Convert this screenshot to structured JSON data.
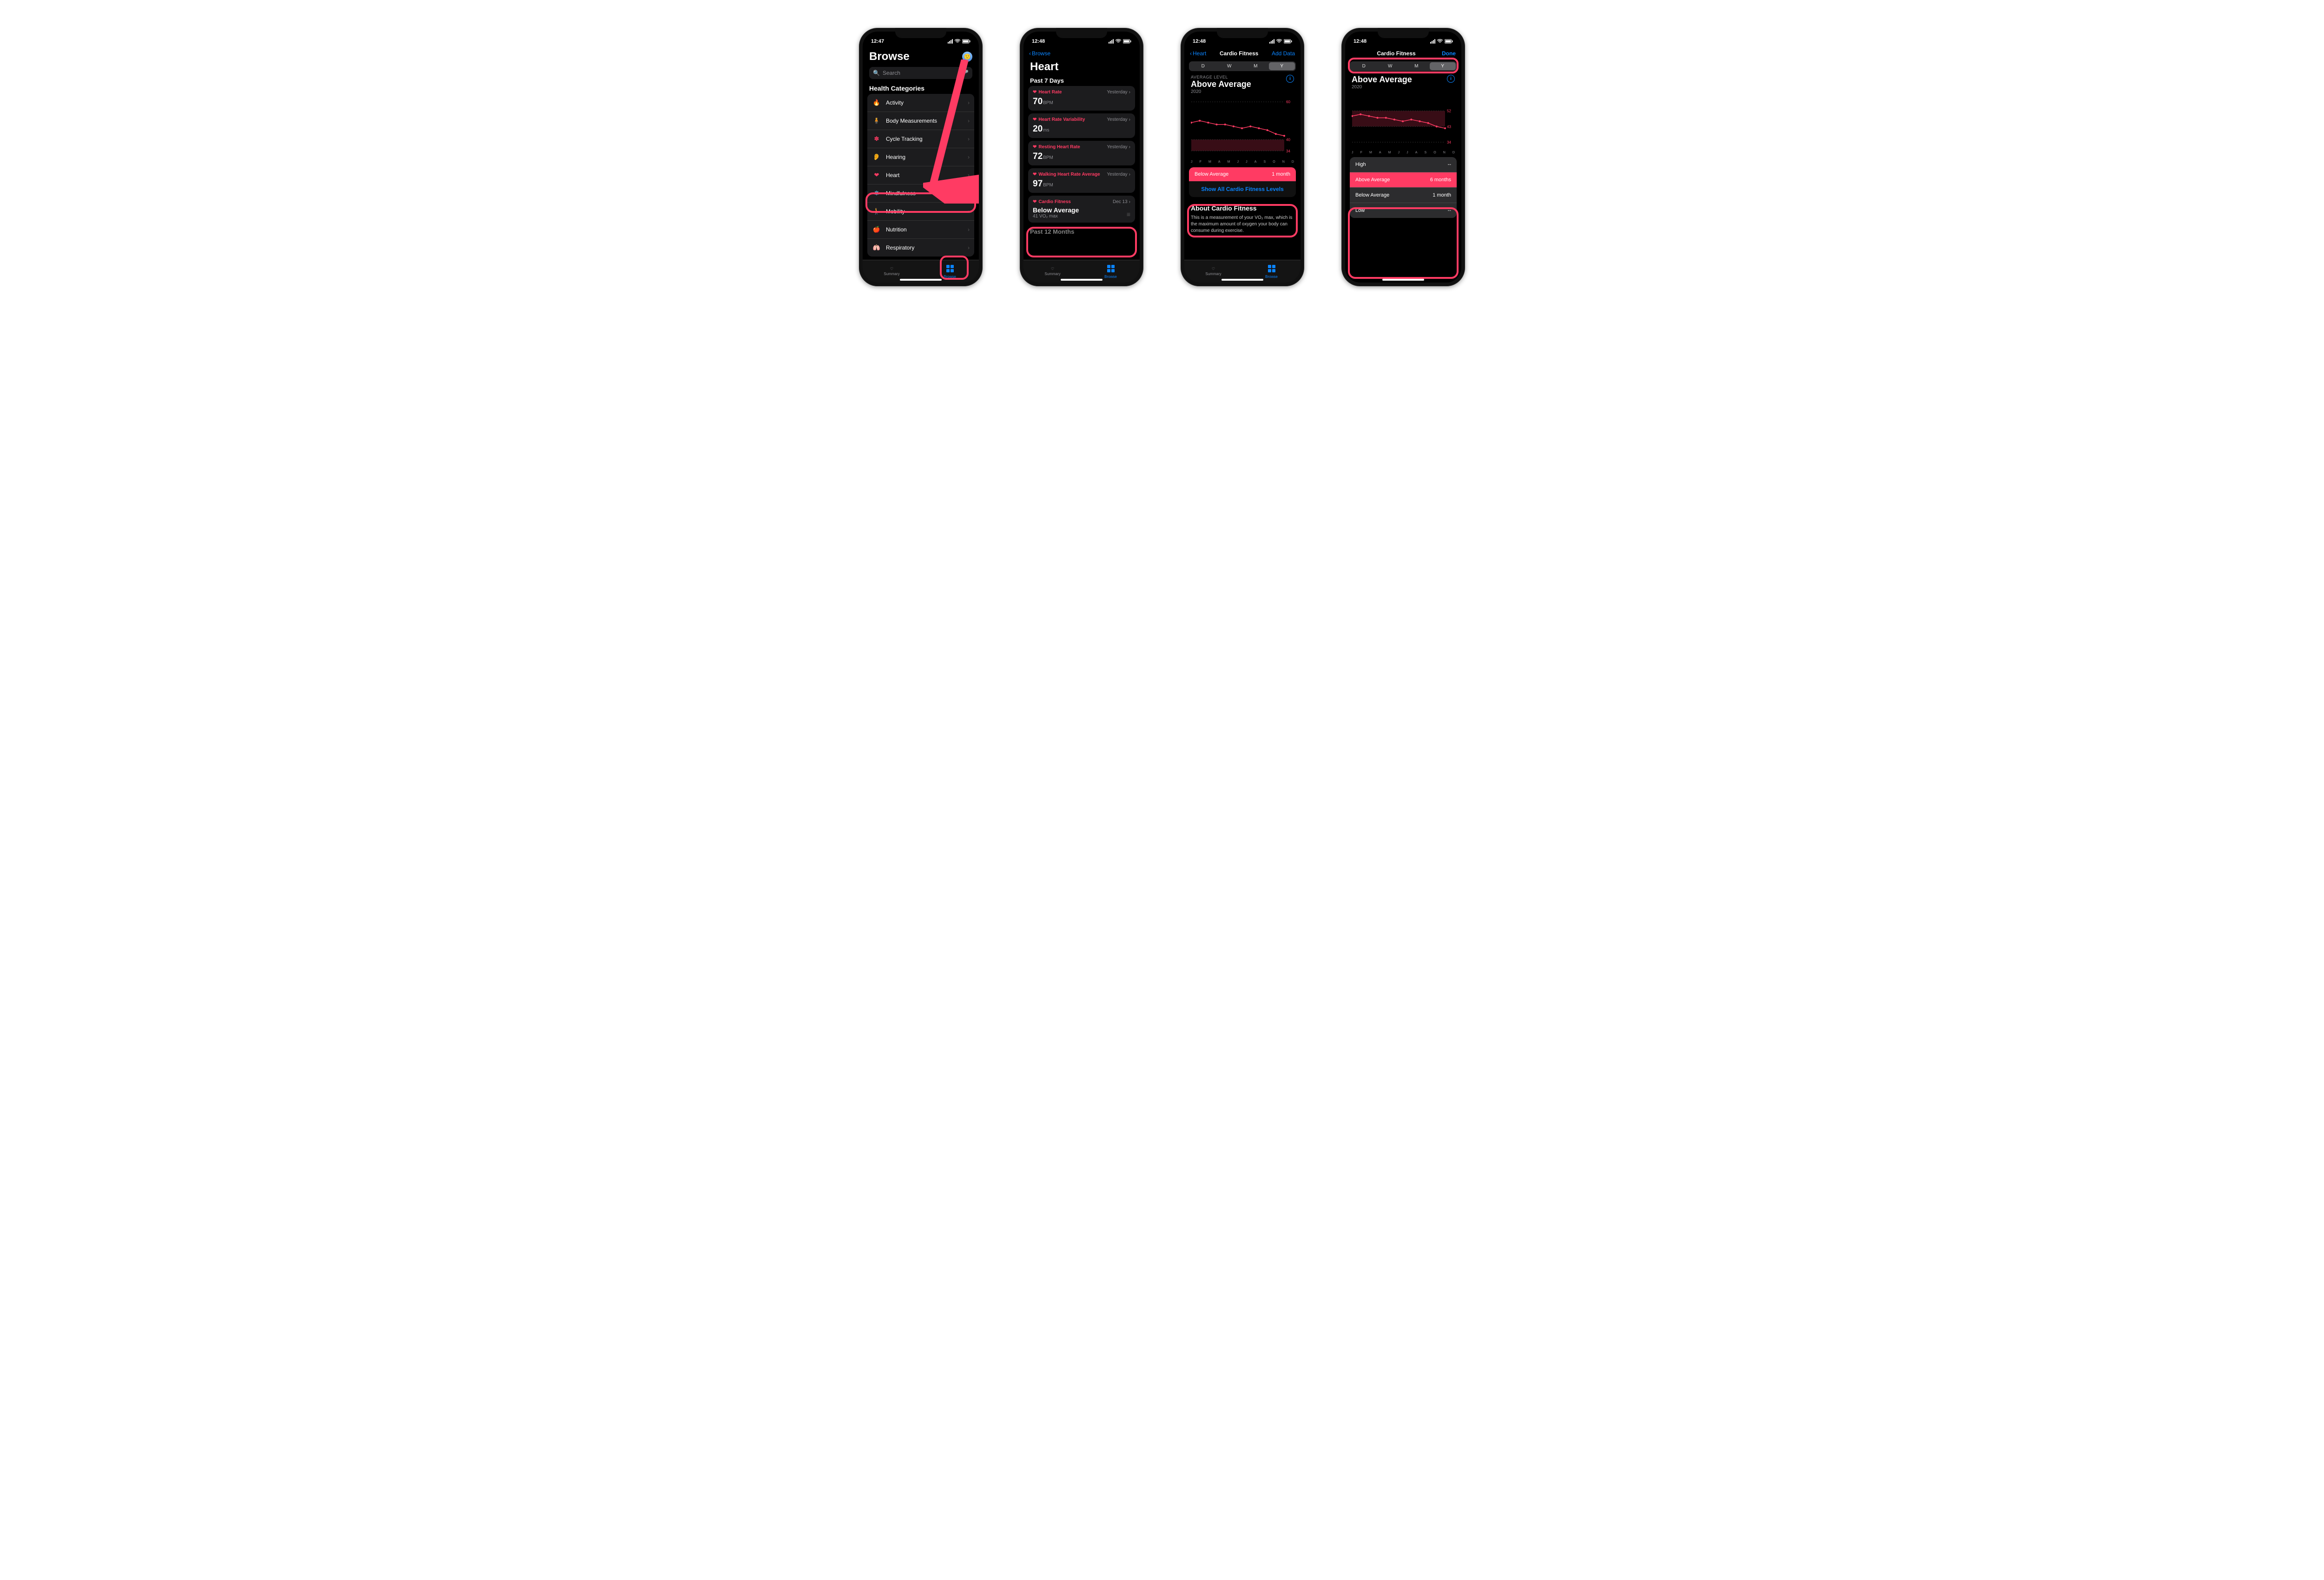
{
  "status": {
    "time_a": "12:47",
    "time_b": "12:48",
    "loc_arrow": "↗"
  },
  "screen1": {
    "title": "Browse",
    "search_placeholder": "Search",
    "categories_header": "Health Categories",
    "categories": [
      {
        "icon": "flame",
        "label": "Activity",
        "color": "#ff9500"
      },
      {
        "icon": "body",
        "label": "Body Measurements",
        "color": "#bf5af2"
      },
      {
        "icon": "cycle",
        "label": "Cycle Tracking",
        "color": "#ff3b63"
      },
      {
        "icon": "ear",
        "label": "Hearing",
        "color": "#0a84ff"
      },
      {
        "icon": "heart",
        "label": "Heart",
        "color": "#ff3b63"
      },
      {
        "icon": "mind",
        "label": "Mindfulness",
        "color": "#64d2ff"
      },
      {
        "icon": "mobility",
        "label": "Mobility",
        "color": "#ff9500"
      },
      {
        "icon": "nutrition",
        "label": "Nutrition",
        "color": "#30d158"
      },
      {
        "icon": "lungs",
        "label": "Respiratory",
        "color": "#5ac8fa"
      }
    ],
    "tabs": {
      "summary": "Summary",
      "browse": "Browse"
    }
  },
  "screen2": {
    "back": "Browse",
    "title": "Heart",
    "section": "Past 7 Days",
    "section2": "Past 12 Months",
    "metrics": [
      {
        "name": "Heart Rate",
        "when": "Yesterday",
        "value": "70",
        "unit": "BPM"
      },
      {
        "name": "Heart Rate Variability",
        "when": "Yesterday",
        "value": "20",
        "unit": "ms"
      },
      {
        "name": "Resting Heart Rate",
        "when": "Yesterday",
        "value": "72",
        "unit": "BPM"
      },
      {
        "name": "Walking Heart Rate Average",
        "when": "Yesterday",
        "value": "97",
        "unit": "BPM"
      },
      {
        "name": "Cardio Fitness",
        "when": "Dec 13",
        "value": "Below Average",
        "sub": "41 VO₂ max"
      }
    ]
  },
  "screen3": {
    "back": "Heart",
    "title": "Cardio Fitness",
    "action": "Add Data",
    "seg": [
      "D",
      "W",
      "M",
      "Y"
    ],
    "seg_sel": 3,
    "avg_label": "AVERAGE LEVEL",
    "level": "Above Average",
    "year": "2020",
    "below_avg_label": "Below Average",
    "below_avg_dur": "1 month",
    "show_all": "Show All Cardio Fitness Levels",
    "about_title": "About Cardio Fitness",
    "about_body": "This is a measurement of your VO₂ max, which is the maximum amount of oxygen your body can consume during exercise."
  },
  "screen4": {
    "title": "Cardio Fitness",
    "done": "Done",
    "seg": [
      "D",
      "W",
      "M",
      "Y"
    ],
    "seg_sel": 3,
    "level": "Above Average",
    "year": "2020",
    "levels": [
      {
        "name": "High",
        "dur": "--"
      },
      {
        "name": "Above Average",
        "dur": "6 months",
        "sel": true,
        "color": "#ff3b63"
      },
      {
        "name": "Below Average",
        "dur": "1 month"
      },
      {
        "name": "Low",
        "dur": "--"
      }
    ]
  },
  "chart_data": {
    "type": "line",
    "title": "Cardio Fitness",
    "ylabel": "VO₂ max",
    "xlabel": "",
    "ylim": [
      30,
      60
    ],
    "year": "2020",
    "ticks_s3": [
      34,
      40,
      60
    ],
    "ticks_s4": [
      34,
      43,
      52
    ],
    "categories": [
      "J",
      "F",
      "M",
      "A",
      "M",
      "J",
      "J",
      "A",
      "S",
      "O",
      "N",
      "D"
    ],
    "series": [
      {
        "name": "VO₂ max",
        "values": [
          49,
          50,
          49,
          48,
          48,
          47,
          46,
          47,
          46,
          45,
          43,
          42
        ]
      }
    ],
    "bands_s3": [
      {
        "name": "Below Average",
        "low": 34,
        "high": 40,
        "color": "#ff3b63"
      }
    ],
    "bands_s4": [
      {
        "name": "Above Average",
        "low": 43,
        "high": 52,
        "color": "#ff3b63"
      }
    ]
  }
}
